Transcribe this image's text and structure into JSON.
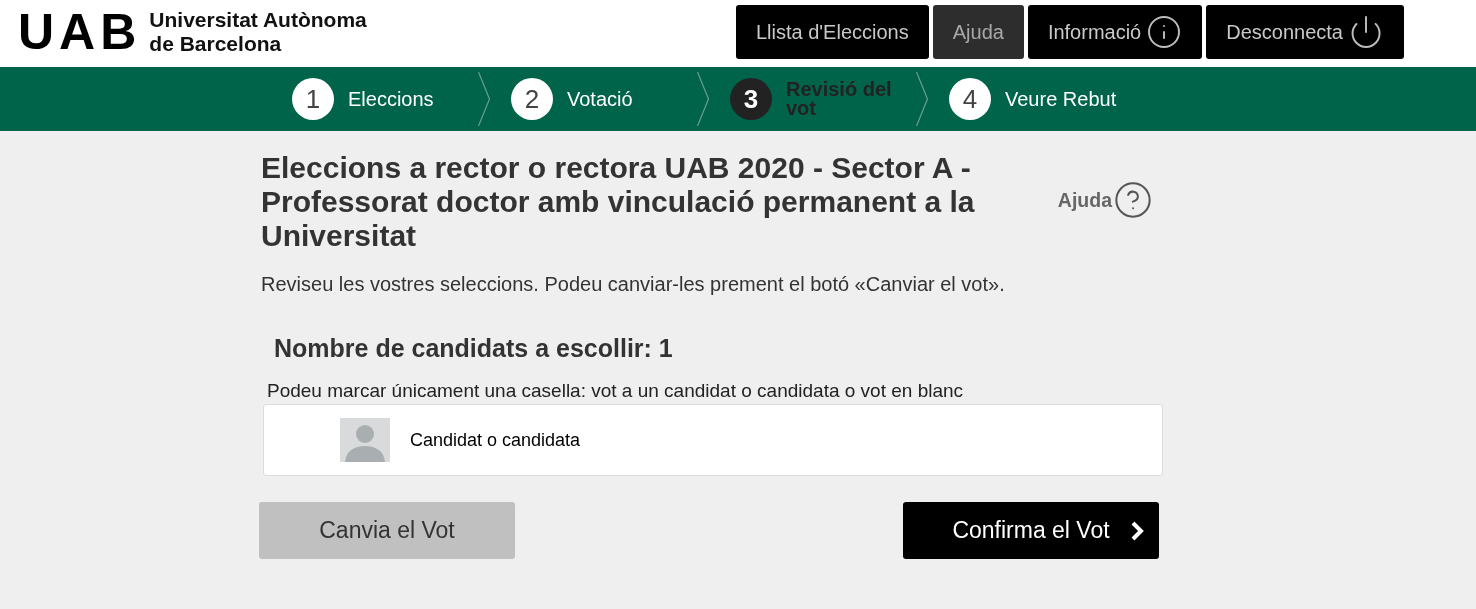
{
  "header": {
    "logo": {
      "mark": "UAB",
      "name_lines": [
        "Universitat Autònoma",
        "de Barcelona"
      ]
    },
    "nav": [
      {
        "label": "Llista d'Eleccions",
        "selected": false,
        "kind": "text"
      },
      {
        "label": "Ajuda",
        "selected": true,
        "kind": "text"
      },
      {
        "label": "Informació",
        "selected": false,
        "kind": "info"
      },
      {
        "label": "Desconnecta",
        "selected": false,
        "kind": "power"
      }
    ]
  },
  "steps": [
    {
      "number": "1",
      "label": "Eleccions",
      "selected": false
    },
    {
      "number": "2",
      "label": "Votació",
      "selected": false
    },
    {
      "number": "3",
      "label": "Revisió del vot",
      "selected": true
    },
    {
      "number": "4",
      "label": "Veure Rebut",
      "selected": false
    }
  ],
  "election": {
    "title": "Eleccions a rector o rectora UAB 2020 - Sector A - Professorat doctor amb vinculació permanent a la Universitat",
    "help": "Ajuda",
    "instructions": "Reviseu les vostres seleccions. Podeu canviar-les prement el botó «Canviar el vot»."
  },
  "ballot": {
    "heading": "Nombre de candidats a escollir: 1",
    "hint": "Podeu marcar únicament una casella: vot a un candidat o candidata o vot en blanc",
    "candidates": [
      {
        "name": "Candidat o candidata"
      }
    ]
  },
  "actions": [
    {
      "label": "Canvia el Vot",
      "kind": "secondary"
    },
    {
      "label": "Confirma el Vot",
      "kind": "primary"
    }
  ]
}
